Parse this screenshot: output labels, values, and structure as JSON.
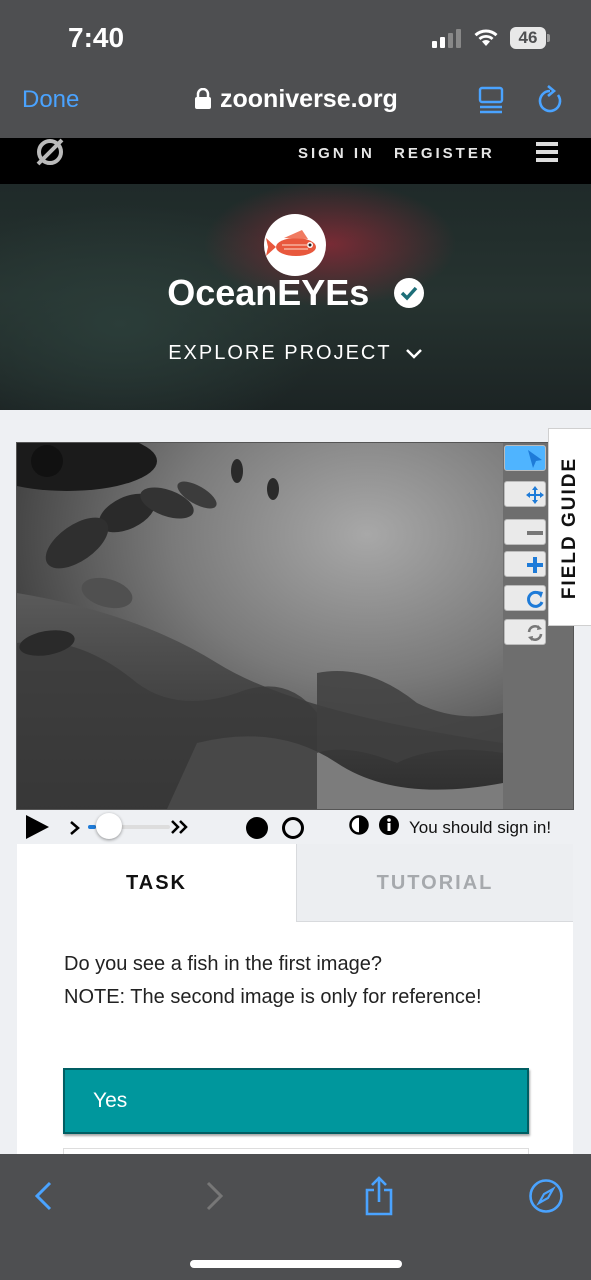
{
  "status_bar": {
    "time": "7:40",
    "battery": "46"
  },
  "browser": {
    "done_label": "Done",
    "domain": "zooniverse.org"
  },
  "site_nav": {
    "sign_in": "SIGN IN",
    "register": "REGISTER"
  },
  "project": {
    "title": "OceanEYEs",
    "explore": "EXPLORE PROJECT"
  },
  "viewer": {
    "field_guide": "FIELD GUIDE",
    "sign_in_message": "You should sign in!",
    "playback_position": 0.1
  },
  "task": {
    "tab_task": "TASK",
    "tab_tutorial": "TUTORIAL",
    "question_line1": "Do you see a fish in the first image?",
    "question_line2": "NOTE: The second image is only for reference!",
    "yes_label": "Yes"
  },
  "colors": {
    "accent": "#00979d",
    "link_blue": "#4aa3ff",
    "active_tool": "#4fb4ff"
  }
}
